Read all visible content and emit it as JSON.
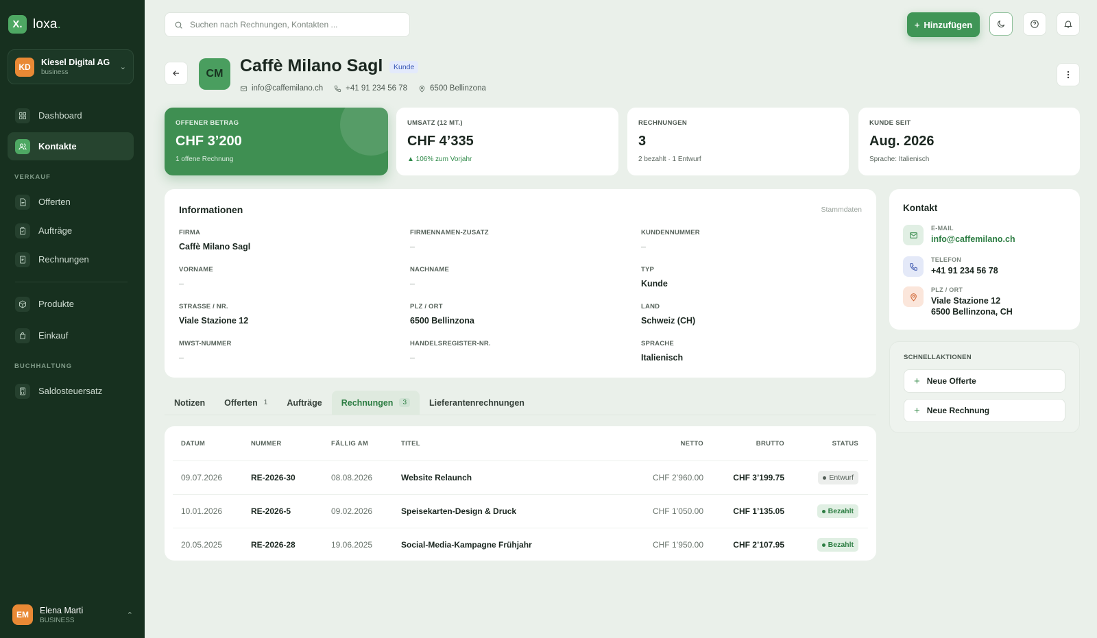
{
  "app": {
    "logo_mark": "X.",
    "logo_name": "loxa",
    "logo_dot": "."
  },
  "org": {
    "initials": "KD",
    "name": "Kiesel Digital AG",
    "plan": "business"
  },
  "nav": {
    "dashboard": "Dashboard",
    "contacts": "Kontakte",
    "section_sales": "VERKAUF",
    "offers": "Offerten",
    "orders": "Aufträge",
    "invoices": "Rechnungen",
    "products": "Produkte",
    "purchasing": "Einkauf",
    "section_accounting": "BUCHHALTUNG",
    "vat_rate": "Saldosteuersatz"
  },
  "user": {
    "initials": "EM",
    "name": "Elena Marti",
    "role": "BUSINESS"
  },
  "search": {
    "placeholder": "Suchen nach Rechnungen, Kontakten ..."
  },
  "toolbar": {
    "add_label": "Hinzufügen"
  },
  "contact": {
    "initials": "CM",
    "name": "Caffè Milano Sagl",
    "badge": "Kunde",
    "email": "info@caffemilano.ch",
    "phone": "+41 91 234 56 78",
    "location": "6500 Bellinzona"
  },
  "kpis": [
    {
      "label": "OFFENER BETRAG",
      "value": "CHF 3’200",
      "sub": "1 offene Rechnung"
    },
    {
      "label": "UMSATZ (12 MT.)",
      "value": "CHF 4’335",
      "sub": "▲ 106% zum Vorjahr"
    },
    {
      "label": "RECHNUNGEN",
      "value": "3",
      "sub": "2 bezahlt · 1 Entwurf"
    },
    {
      "label": "KUNDE SEIT",
      "value": "Aug. 2026",
      "sub": "Sprache: Italienisch"
    }
  ],
  "info": {
    "title": "Informationen",
    "link": "Stammdaten",
    "fields": [
      {
        "label": "FIRMA",
        "value": "Caffè Milano Sagl"
      },
      {
        "label": "FIRMENNAMEN-ZUSATZ",
        "value": "–"
      },
      {
        "label": "KUNDENNUMMER",
        "value": "–"
      },
      {
        "label": "VORNAME",
        "value": "–"
      },
      {
        "label": "NACHNAME",
        "value": "–"
      },
      {
        "label": "TYP",
        "value": "Kunde"
      },
      {
        "label": "STRASSE / NR.",
        "value": "Viale Stazione 12"
      },
      {
        "label": "PLZ / ORT",
        "value": "6500 Bellinzona"
      },
      {
        "label": "LAND",
        "value": "Schweiz (CH)"
      },
      {
        "label": "MWST-NUMMER",
        "value": "–"
      },
      {
        "label": "HANDELSREGISTER-NR.",
        "value": "–"
      },
      {
        "label": "SPRACHE",
        "value": "Italienisch"
      }
    ]
  },
  "contact_card": {
    "title": "Kontakt",
    "email_label": "E-MAIL",
    "email": "info@caffemilano.ch",
    "phone_label": "TELEFON",
    "phone": "+41 91 234 56 78",
    "address_label": "PLZ / ORT",
    "address_line1": "Viale Stazione 12",
    "address_line2": "6500 Bellinzona, CH"
  },
  "quick_actions": {
    "title": "SCHNELLAKTIONEN",
    "new_offer": "Neue Offerte",
    "new_invoice": "Neue Rechnung"
  },
  "tabs": [
    {
      "label": "Notizen",
      "count": ""
    },
    {
      "label": "Offerten",
      "count": "1"
    },
    {
      "label": "Aufträge",
      "count": ""
    },
    {
      "label": "Rechnungen",
      "count": "3"
    },
    {
      "label": "Lieferantenrechnungen",
      "count": ""
    }
  ],
  "table": {
    "headers": {
      "date": "DATUM",
      "number": "NUMMER",
      "due": "FÄLLIG AM",
      "title": "TITEL",
      "net": "NETTO",
      "gross": "BRUTTO",
      "status": "STATUS"
    },
    "rows": [
      {
        "date": "09.07.2026",
        "number": "RE-2026-30",
        "due": "08.08.2026",
        "title": "Website Relaunch",
        "net": "CHF 2’960.00",
        "gross": "CHF 3’199.75",
        "status": "Entwurf"
      },
      {
        "date": "10.01.2026",
        "number": "RE-2026-5",
        "due": "09.02.2026",
        "title": "Speisekarten-Design & Druck",
        "net": "CHF 1’050.00",
        "gross": "CHF 1’135.05",
        "status": "Bezahlt"
      },
      {
        "date": "20.05.2025",
        "number": "RE-2026-28",
        "due": "19.06.2025",
        "title": "Social-Media-Kampagne Frühjahr",
        "net": "CHF 1’950.00",
        "gross": "CHF 2’107.95",
        "status": "Bezahlt"
      }
    ]
  },
  "colors": {
    "accent": "#3f8f52",
    "sidebar": "#17301f",
    "background": "#eaf0ea"
  }
}
